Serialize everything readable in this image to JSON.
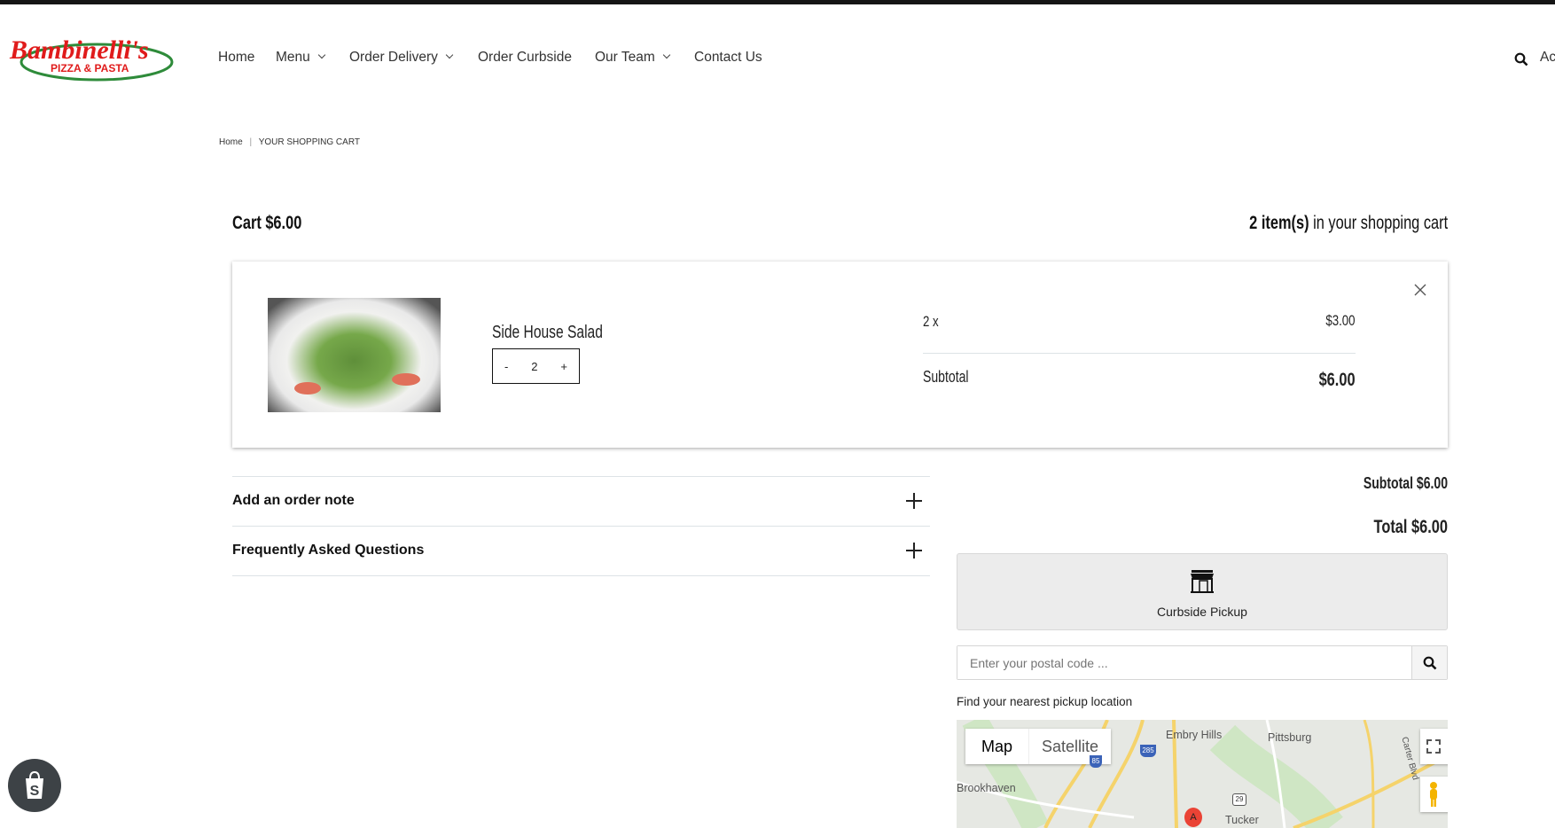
{
  "header": {
    "logo_text": "Bambinelli's",
    "logo_sub": "PIZZA & PASTA",
    "nav": [
      {
        "label": "Home"
      },
      {
        "label": "Menu"
      },
      {
        "label": "Order Delivery"
      },
      {
        "label": "Order Curbside"
      },
      {
        "label": "Our Team"
      },
      {
        "label": "Contact Us"
      }
    ],
    "account_label": "Ac"
  },
  "breadcrumb": {
    "home": "Home",
    "sep": "|",
    "current": "YOUR SHOPPING CART"
  },
  "cart": {
    "title": "Cart $6.00",
    "count_bold": "2 item(s)",
    "count_rest": " in your shopping cart",
    "item": {
      "name": "Side House Salad",
      "qty": "2",
      "minus": "-",
      "plus": "+",
      "qty_label": "2 x",
      "unit_price": "$3.00",
      "subtotal_label": "Subtotal",
      "subtotal": "$6.00"
    }
  },
  "accordion": [
    {
      "label": "Add an order note"
    },
    {
      "label": "Frequently Asked Questions"
    }
  ],
  "summary": {
    "subtotal": "Subtotal $6.00",
    "total": "Total $6.00"
  },
  "pickup": {
    "label": "Curbside Pickup",
    "placeholder": "Enter your postal code ...",
    "find_text": "Find your nearest pickup location"
  },
  "map": {
    "tab_map": "Map",
    "tab_satellite": "Satellite",
    "places": [
      "Embry Hills",
      "Pittsburg",
      "Brookhaven",
      "Tucker",
      "Carter Blvd"
    ],
    "shields": [
      "85",
      "285",
      "29"
    ],
    "marker": "A"
  }
}
